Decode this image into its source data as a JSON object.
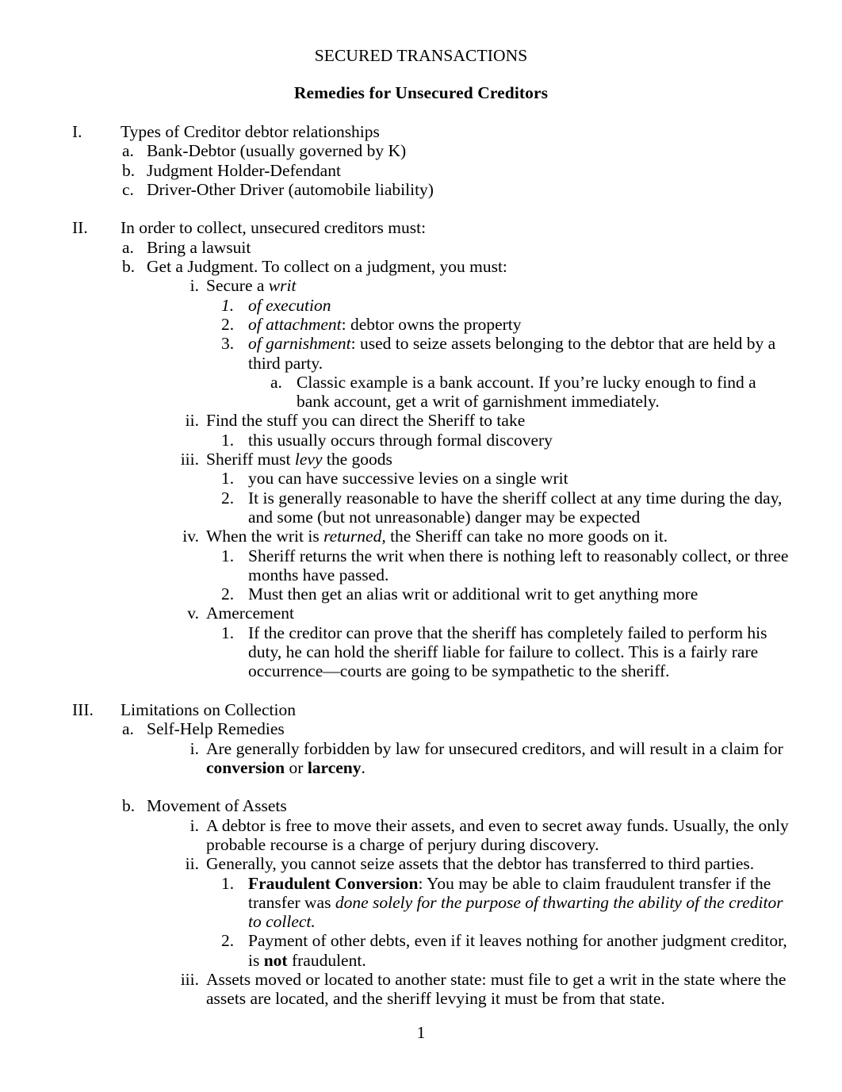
{
  "document": {
    "title": "SECURED TRANSACTIONS",
    "subtitle": "Remedies for Unsecured Creditors",
    "page_number": "1"
  },
  "outline": {
    "i_marker": "I.",
    "i_text": "Types of Creditor debtor relationships",
    "i_a_marker": "a.",
    "i_a_text": "Bank-Debtor (usually governed by K)",
    "i_b_marker": "b.",
    "i_b_text": "Judgment Holder-Defendant",
    "i_c_marker": "c.",
    "i_c_text": "Driver-Other Driver (automobile liability)",
    "ii_marker": "II.",
    "ii_text": "In order to collect, unsecured creditors must:",
    "ii_a_marker": "a.",
    "ii_a_text": "Bring a lawsuit",
    "ii_b_marker": "b.",
    "ii_b_text": "Get a Judgment.  To collect on a judgment, you must:",
    "ii_b_i_marker": "i.",
    "ii_b_i_text_1": "Secure a ",
    "ii_b_i_text_2": "writ",
    "ii_b_i_1_marker": "1.",
    "ii_b_i_1_text": "of execution",
    "ii_b_i_2_marker": "2.",
    "ii_b_i_2_text_1": "of attachment",
    "ii_b_i_2_text_2": ":  debtor owns the property",
    "ii_b_i_3_marker": "3.",
    "ii_b_i_3_text_1": "of garnishment",
    "ii_b_i_3_text_2": ":  used to seize assets belonging to the debtor that are held by a third party.",
    "ii_b_i_3_a_marker": "a.",
    "ii_b_i_3_a_text": "Classic example is a bank account.  If you’re lucky enough to find a bank account, get a writ of garnishment immediately.",
    "ii_b_ii_marker": "ii.",
    "ii_b_ii_text": "Find the stuff you can direct the Sheriff to take",
    "ii_b_ii_1_marker": "1.",
    "ii_b_ii_1_text": "this usually occurs through formal discovery",
    "ii_b_iii_marker": "iii.",
    "ii_b_iii_text_1": "Sheriff must ",
    "ii_b_iii_text_2": "levy",
    "ii_b_iii_text_3": " the goods",
    "ii_b_iii_1_marker": "1.",
    "ii_b_iii_1_text": "you can have successive levies on a single writ",
    "ii_b_iii_2_marker": "2.",
    "ii_b_iii_2_text": "It is generally reasonable to have the sheriff collect at any time during the day, and some (but not unreasonable) danger may be expected",
    "ii_b_iv_marker": "iv.",
    "ii_b_iv_text_1": "When the writ is ",
    "ii_b_iv_text_2": "returned,",
    "ii_b_iv_text_3": " the Sheriff can take no more goods on it.",
    "ii_b_iv_1_marker": "1.",
    "ii_b_iv_1_text": "Sheriff returns the writ when there is nothing left to reasonably collect, or three months have passed.",
    "ii_b_iv_2_marker": "2.",
    "ii_b_iv_2_text": "Must then get an alias writ or additional writ to get anything more",
    "ii_b_v_marker": "v.",
    "ii_b_v_text": "Amercement",
    "ii_b_v_1_marker": "1.",
    "ii_b_v_1_text": "If the creditor can prove that the sheriff has completely failed to perform his duty, he can hold the sheriff liable for failure to collect.  This is a fairly rare occurrence—courts are going to be sympathetic to the sheriff.",
    "iii_marker": "III.",
    "iii_text": "Limitations on Collection",
    "iii_a_marker": "a.",
    "iii_a_text": "Self-Help Remedies",
    "iii_a_i_marker": "i.",
    "iii_a_i_text_1": "Are generally forbidden by law for unsecured creditors, and will result in a claim for ",
    "iii_a_i_text_2": "conversion",
    "iii_a_i_text_3": " or ",
    "iii_a_i_text_4": "larceny",
    "iii_a_i_text_5": ".",
    "iii_b_marker": "b.",
    "iii_b_text": "Movement of Assets",
    "iii_b_i_marker": "i.",
    "iii_b_i_text": "A debtor is free to move their assets, and even to secret away funds.  Usually, the only probable recourse is a charge of perjury during discovery.",
    "iii_b_ii_marker": "ii.",
    "iii_b_ii_text": "Generally, you cannot seize assets that the debtor has transferred to third parties.",
    "iii_b_ii_1_marker": "1.",
    "iii_b_ii_1_text_1": "Fraudulent Conversion",
    "iii_b_ii_1_text_2": ":  You may be able to claim fraudulent transfer if the transfer was ",
    "iii_b_ii_1_text_3": "done solely for the purpose of thwarting the ability of the creditor to collect.",
    "iii_b_ii_2_marker": "2.",
    "iii_b_ii_2_text_1": "Payment of other debts, even if it leaves nothing for another judgment creditor, is ",
    "iii_b_ii_2_text_2": "not",
    "iii_b_ii_2_text_3": " fraudulent.",
    "iii_b_iii_marker": "iii.",
    "iii_b_iii_text": "Assets moved or located to another state: must file to get a writ in the state where the assets are located, and the sheriff levying it must be from that state."
  }
}
